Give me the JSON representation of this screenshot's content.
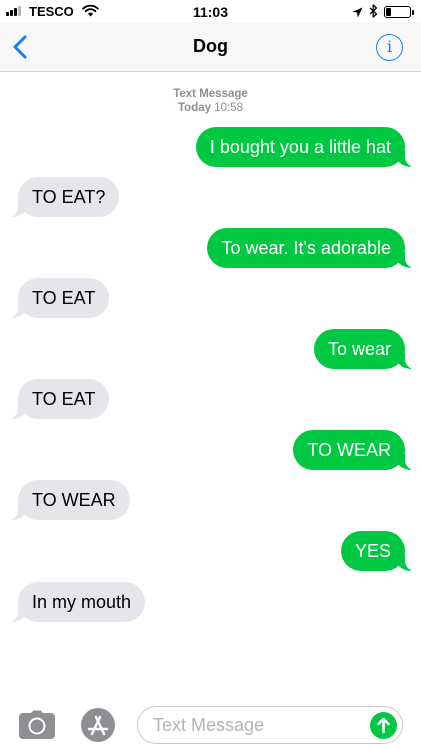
{
  "status_bar": {
    "carrier": "TESCO",
    "time": "11:03",
    "battery_level": 0.2,
    "icons": [
      "signal-icon",
      "wifi-icon",
      "location-arrow-icon",
      "bluetooth-icon",
      "battery-icon"
    ]
  },
  "nav": {
    "title": "Dog",
    "back_icon": "chevron-left-icon",
    "info_label": "i",
    "accent_color": "#1a7cf5"
  },
  "thread": {
    "service": "Text Message",
    "day": "Today",
    "time": "10:58"
  },
  "messages": [
    {
      "from": "me",
      "text": "I bought you a little hat"
    },
    {
      "from": "them",
      "text": "TO EAT?"
    },
    {
      "from": "me",
      "text": "To wear. It's adorable"
    },
    {
      "from": "them",
      "text": "TO EAT"
    },
    {
      "from": "me",
      "text": "To wear"
    },
    {
      "from": "them",
      "text": "TO EAT"
    },
    {
      "from": "me",
      "text": "TO WEAR"
    },
    {
      "from": "them",
      "text": "TO WEAR"
    },
    {
      "from": "me",
      "text": "YES"
    },
    {
      "from": "them",
      "text": "In my mouth"
    }
  ],
  "colors": {
    "outgoing_bubble": "#00c843",
    "incoming_bubble": "#e6e5ea"
  },
  "input": {
    "placeholder": "Text Message",
    "camera_icon": "camera-icon",
    "apps_icon": "app-store-icon",
    "send_icon": "arrow-up-icon"
  }
}
